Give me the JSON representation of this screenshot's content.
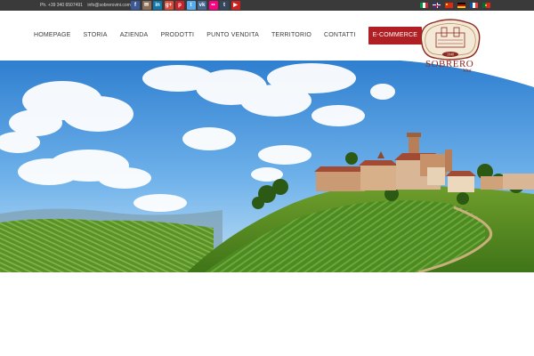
{
  "topbar": {
    "phone": "Ph. +39 340 6507491",
    "email": "info@sobrerovini.com",
    "socials": [
      {
        "icon": "facebook-icon",
        "glyph": "f",
        "color": "#3b5998"
      },
      {
        "icon": "email-icon",
        "glyph": "✉",
        "color": "#8a6e5a"
      },
      {
        "icon": "linkedin-icon",
        "glyph": "in",
        "color": "#0e76a8"
      },
      {
        "icon": "googleplus-icon",
        "glyph": "g+",
        "color": "#dd4b39"
      },
      {
        "icon": "pinterest-icon",
        "glyph": "p",
        "color": "#cb2027"
      },
      {
        "icon": "twitter-icon",
        "glyph": "t",
        "color": "#55acee"
      },
      {
        "icon": "vk-icon",
        "glyph": "vk",
        "color": "#45668e"
      },
      {
        "icon": "flickr-icon",
        "glyph": "••",
        "color": "#ff0084"
      },
      {
        "icon": "tumblr-icon",
        "glyph": "t",
        "color": "#35465c"
      },
      {
        "icon": "youtube-icon",
        "glyph": "▶",
        "color": "#cd201f"
      }
    ],
    "languages": [
      {
        "name": "italian-flag-icon"
      },
      {
        "name": "english-flag-icon"
      },
      {
        "name": "chinese-flag-icon"
      },
      {
        "name": "german-flag-icon"
      },
      {
        "name": "french-flag-icon"
      },
      {
        "name": "portuguese-flag-icon"
      }
    ]
  },
  "nav": {
    "items": [
      "HOMEPAGE",
      "STORIA",
      "AZIENDA",
      "PRODOTTI",
      "PUNTO VENDITA",
      "TERRITORIO",
      "CONTATTI"
    ],
    "ecommerce": "E-COMMERCE",
    "cart_icon": "cart-icon"
  },
  "logo": {
    "name": "SOBRERO",
    "sub": "Vini",
    "year": "1940"
  },
  "colors": {
    "topbar": "#3a3a3a",
    "accent": "#b01f24",
    "logo": "#8c2a22"
  }
}
